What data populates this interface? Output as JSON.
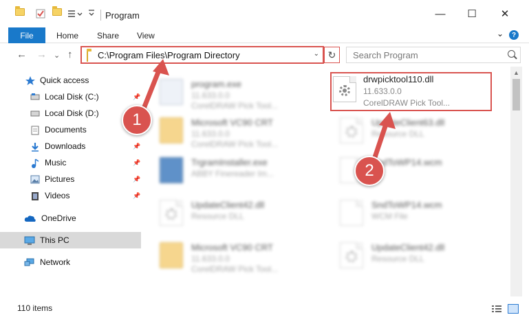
{
  "window": {
    "title": "Program",
    "minimize_glyph": "—",
    "maximize_glyph": "☐",
    "close_glyph": "✕"
  },
  "ribbon": {
    "file": "File",
    "home": "Home",
    "share": "Share",
    "view": "View",
    "expand_glyph": "⌄",
    "help_glyph": "?"
  },
  "address": {
    "path": "C:\\Program Files\\Program Directory",
    "dropdown_glyph": "⌄",
    "refresh_glyph": "↻",
    "search_placeholder": "Search Program",
    "back_glyph": "←",
    "forward_glyph": "→",
    "recent_glyph": "⌄",
    "up_glyph": "↑"
  },
  "nav": {
    "items": [
      {
        "label": "Quick access",
        "icon": "star-icon"
      },
      {
        "label": "Local Disk (C:)",
        "icon": "drive-icon"
      },
      {
        "label": "Local Disk (D:)",
        "icon": "drive-icon"
      },
      {
        "label": "Documents",
        "icon": "documents-icon"
      },
      {
        "label": "Downloads",
        "icon": "download-icon"
      },
      {
        "label": "Music",
        "icon": "music-icon"
      },
      {
        "label": "Pictures",
        "icon": "pictures-icon"
      },
      {
        "label": "Videos",
        "icon": "videos-icon"
      },
      {
        "label": "OneDrive",
        "icon": "cloud-icon"
      },
      {
        "label": "This PC",
        "icon": "computer-icon"
      },
      {
        "label": "Network",
        "icon": "network-icon"
      }
    ],
    "pin_glyph": "📌"
  },
  "files": [
    {
      "name": "program.exe",
      "meta1": "11.633.0.0",
      "meta2": "CorelDRAW Pick Tool..."
    },
    {
      "name": "drwpicktool110.dll",
      "meta1": "11.633.0.0",
      "meta2": "CorelDRAW Pick Tool..."
    },
    {
      "name": "Microsoft VC90 CRT",
      "meta1": "11.633.0.0",
      "meta2": "CorelDRAW Pick Tool..."
    },
    {
      "name": "UpdateClient63.dll",
      "meta1": "Resource DLL",
      "meta2": ""
    },
    {
      "name": "TrgramInstaller.exe",
      "meta1": "ABBY Finereader Im...",
      "meta2": ""
    },
    {
      "name": "SndToWP14.wcm",
      "meta1": "",
      "meta2": ""
    },
    {
      "name": "UpdateClient42.dll",
      "meta1": "Resource DLL",
      "meta2": ""
    },
    {
      "name": "SndToWP14.wcm",
      "meta1": "WCM File",
      "meta2": ""
    },
    {
      "name": "Microsoft VC90 CRT",
      "meta1": "11.633.0.0",
      "meta2": "CorelDRAW Pick Tool..."
    },
    {
      "name": "UpdateClient42.dll",
      "meta1": "Resource DLL",
      "meta2": ""
    }
  ],
  "status": {
    "count": "110 items"
  },
  "callouts": {
    "one": "1",
    "two": "2"
  },
  "colors": {
    "accent": "#1979ca",
    "highlight": "#d9534f",
    "selected": "#d9d9d9"
  }
}
